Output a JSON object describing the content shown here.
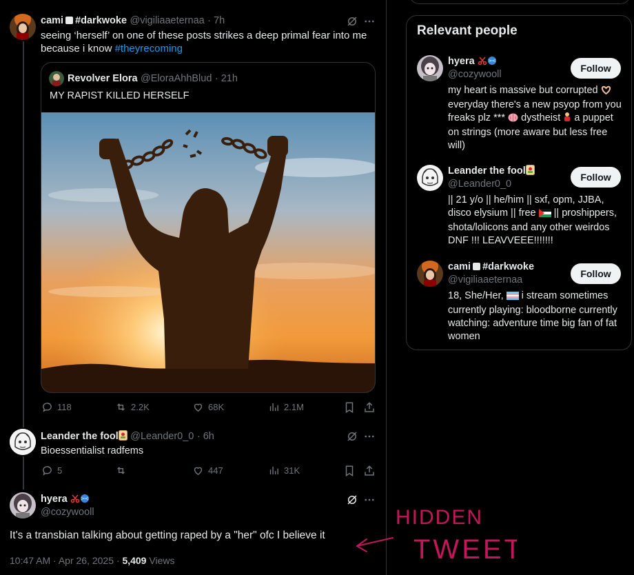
{
  "tweet1": {
    "name": "cami",
    "name_tag": "#darkwoke",
    "handle": "@vigiliaaeternaa",
    "time": "· 7h",
    "text_before": "seeing ‘herself’ on one of these posts strikes a deep primal fear into me because i know ",
    "hashtag": "#theyrecoming"
  },
  "quote": {
    "name": "Revolver Elora",
    "handle": "@EloraAhhBlud",
    "time": "· 21h",
    "text": "MY RAPIST KILLED HERSELF"
  },
  "tweet1_actions": {
    "replies": "118",
    "reposts": "2.2K",
    "likes": "68K",
    "views": "2.1M"
  },
  "tweet2": {
    "name": "Leander the fool",
    "handle": "@Leander0_0",
    "time": "· 6h",
    "text": "Bioessentialist radfems"
  },
  "tweet2_actions": {
    "replies": "5",
    "likes": "447",
    "views": "31K"
  },
  "main_tweet": {
    "name": "hyera",
    "handle": "@cozywooll",
    "text": "It's a transbian talking about getting raped by a \"her\" ofc I believe it",
    "date": "10:47 AM · Apr 26, 2025 · ",
    "views_count": "5,409",
    "views_label": " Views"
  },
  "annotation": {
    "line1": "HIDDEN",
    "line2": "TWEET",
    "color": "#c2185b"
  },
  "relevant": {
    "title": "Relevant people",
    "people": [
      {
        "name": "hyera",
        "handle": "@cozywooll",
        "follow": "Follow",
        "bio_a": "my heart is massive but corrupted ",
        "bio_b": " everyday there's a new psyop from you freaks plz *** ",
        "bio_c": " dystheist ",
        "bio_d": " a puppet on strings (more aware but less free will)"
      },
      {
        "name": "Leander the fool",
        "handle": "@Leander0_0",
        "follow": "Follow",
        "bio_a": "|| 21 y/o || he/him || sxf, opm, JJBA, disco elysium || free ",
        "bio_b": " || proshippers, shota/lolicons and any other weirdos DNF !!! LEAVVEEE!!!!!!!"
      },
      {
        "name": "cami",
        "name_tag": "#darkwoke",
        "handle": "@vigiliaaeternaa",
        "follow": "Follow",
        "bio_a": "18, She/Her, ",
        "bio_b": " i stream sometimes currently playing: bloodborne currently watching: adventure time big fan of fat women"
      }
    ]
  },
  "colors": {
    "link": "#1d9bf0",
    "muted": "#71767b",
    "border": "#2f3336"
  }
}
